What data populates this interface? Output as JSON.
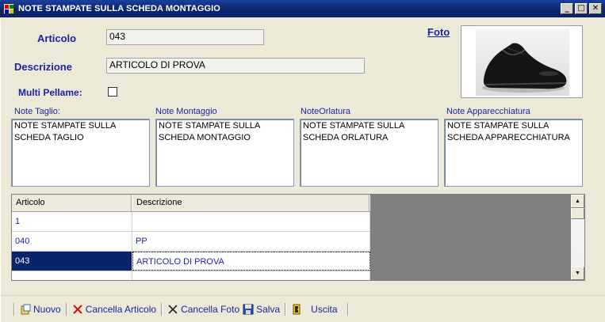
{
  "window": {
    "title": "NOTE STAMPATE SULLA SCHEDA MONTAGGIO",
    "minimize_glyph": "_",
    "maximize_glyph": "□",
    "close_glyph": "✕"
  },
  "form": {
    "articolo_label": "Articolo",
    "articolo_value": "043",
    "descrizione_label": "Descrizione",
    "descrizione_value": "ARTICOLO DI PROVA",
    "multi_pellame_label": "Multi Pellame:",
    "multi_pellame_checked": false,
    "foto_label": "Foto"
  },
  "notes": [
    {
      "label": "Note Taglio:",
      "text": "NOTE STAMPATE SULLA\nSCHEDA TAGLIO"
    },
    {
      "label": "Note Montaggio",
      "text": "NOTE STAMPATE SULLA\nSCHEDA MONTAGGIO"
    },
    {
      "label": "NoteOrlatura",
      "text": "NOTE STAMPATE SULLA\nSCHEDA ORLATURA"
    },
    {
      "label": "Note Apparecchiatura",
      "text": "NOTE STAMPATE SULLA\nSCHEDA APPARECCHIATURA"
    }
  ],
  "grid": {
    "columns": [
      "Articolo",
      "Descrizione"
    ],
    "rows": [
      {
        "articolo": "1",
        "descrizione": ""
      },
      {
        "articolo": "040",
        "descrizione": "PP"
      },
      {
        "articolo": "043",
        "descrizione": "ARTICOLO DI PROVA",
        "selected": true
      }
    ]
  },
  "toolbar": {
    "nuovo": "Nuovo",
    "cancella_articolo": "Cancella Articolo",
    "cancella_foto": "Cancella Foto",
    "salva": "Salva",
    "uscita": "Uscita"
  },
  "icons": {
    "nuovo": "new-document-icon",
    "cancella_articolo": "red-x-icon",
    "cancella_foto": "black-x-icon",
    "salva": "floppy-disk-icon",
    "uscita": "exit-door-icon"
  },
  "colors": {
    "title_bar": "#0a246a",
    "label_blue": "#1c24a4",
    "selection": "#0a246a",
    "window_bg": "#ece9d8"
  }
}
